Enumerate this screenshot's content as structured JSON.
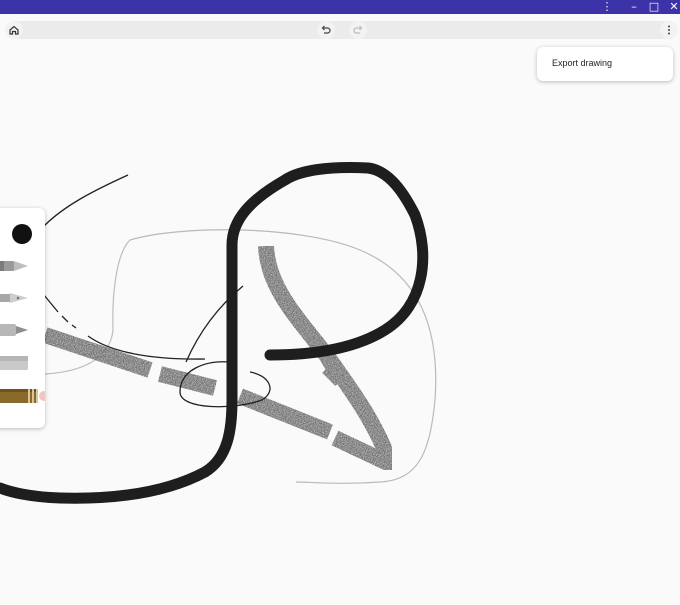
{
  "window": {
    "more_glyph": "⋮",
    "minimize_glyph": "–",
    "maximize_glyph": "□",
    "close_glyph": "✕"
  },
  "toolbar": {
    "home_icon": "home-icon",
    "undo_icon": "undo-icon",
    "redo_icon": "redo-icon",
    "overflow_icon": "more-vert-icon"
  },
  "menu": {
    "export_label": "Export drawing"
  },
  "palette": {
    "tools": [
      "color-swatch",
      "ballpoint-pen",
      "fountain-pen",
      "marker",
      "pencil",
      "highlighter"
    ],
    "selected_color": "#111111",
    "highlighter_color": "#8a6a2a"
  },
  "colors": {
    "titlebar": "#3c33a8",
    "canvas": "#fafafa",
    "ink": "#1e1e1e"
  }
}
